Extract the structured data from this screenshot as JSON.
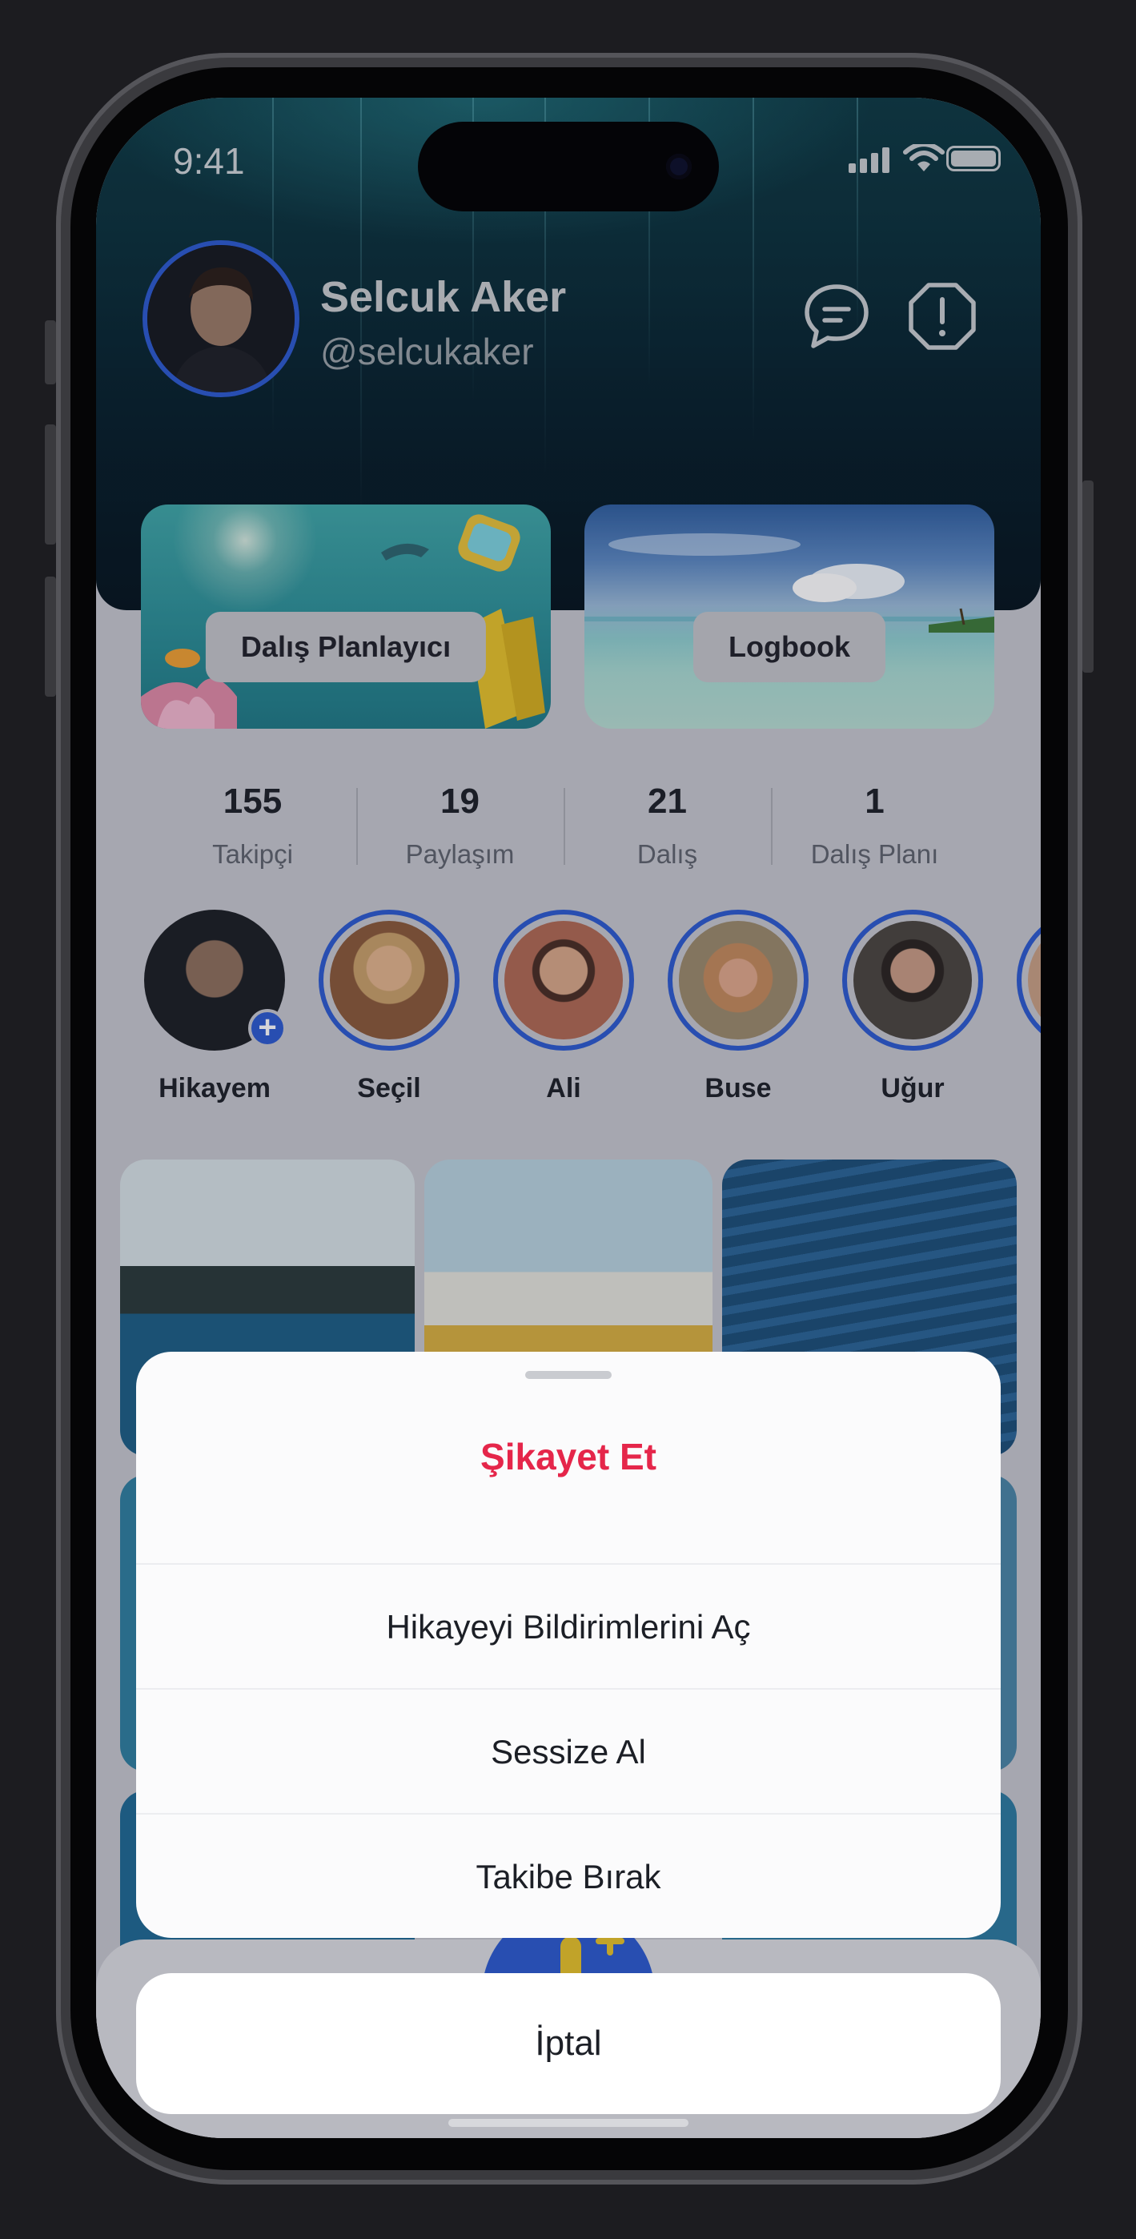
{
  "status_bar": {
    "time": "9:41"
  },
  "profile": {
    "name": "Selcuk Aker",
    "handle": "@selcukaker"
  },
  "header_icons": {
    "message": "chat-bubble-icon",
    "report": "exclamation-octagon-icon"
  },
  "cards": [
    {
      "label": "Dalış Planlayıcı"
    },
    {
      "label": "Logbook"
    }
  ],
  "stats": [
    {
      "value": "155",
      "label": "Takipçi"
    },
    {
      "value": "19",
      "label": "Paylaşım"
    },
    {
      "value": "21",
      "label": "Dalış"
    },
    {
      "value": "1",
      "label": "Dalış Planı"
    }
  ],
  "stories": [
    {
      "name": "Hikayem"
    },
    {
      "name": "Seçil"
    },
    {
      "name": "Ali"
    },
    {
      "name": "Buse"
    },
    {
      "name": "Uğur"
    }
  ],
  "sheet": {
    "title": "Şikayet Et",
    "items": [
      "Hikayeyi Bildirimlerini Aç",
      "Sessize Al",
      "Takibe Bırak"
    ],
    "cancel": "İptal"
  },
  "colors": {
    "accent_blue": "#2c5bd0",
    "danger": "#e5264a",
    "hero_dark": "#07202c"
  }
}
